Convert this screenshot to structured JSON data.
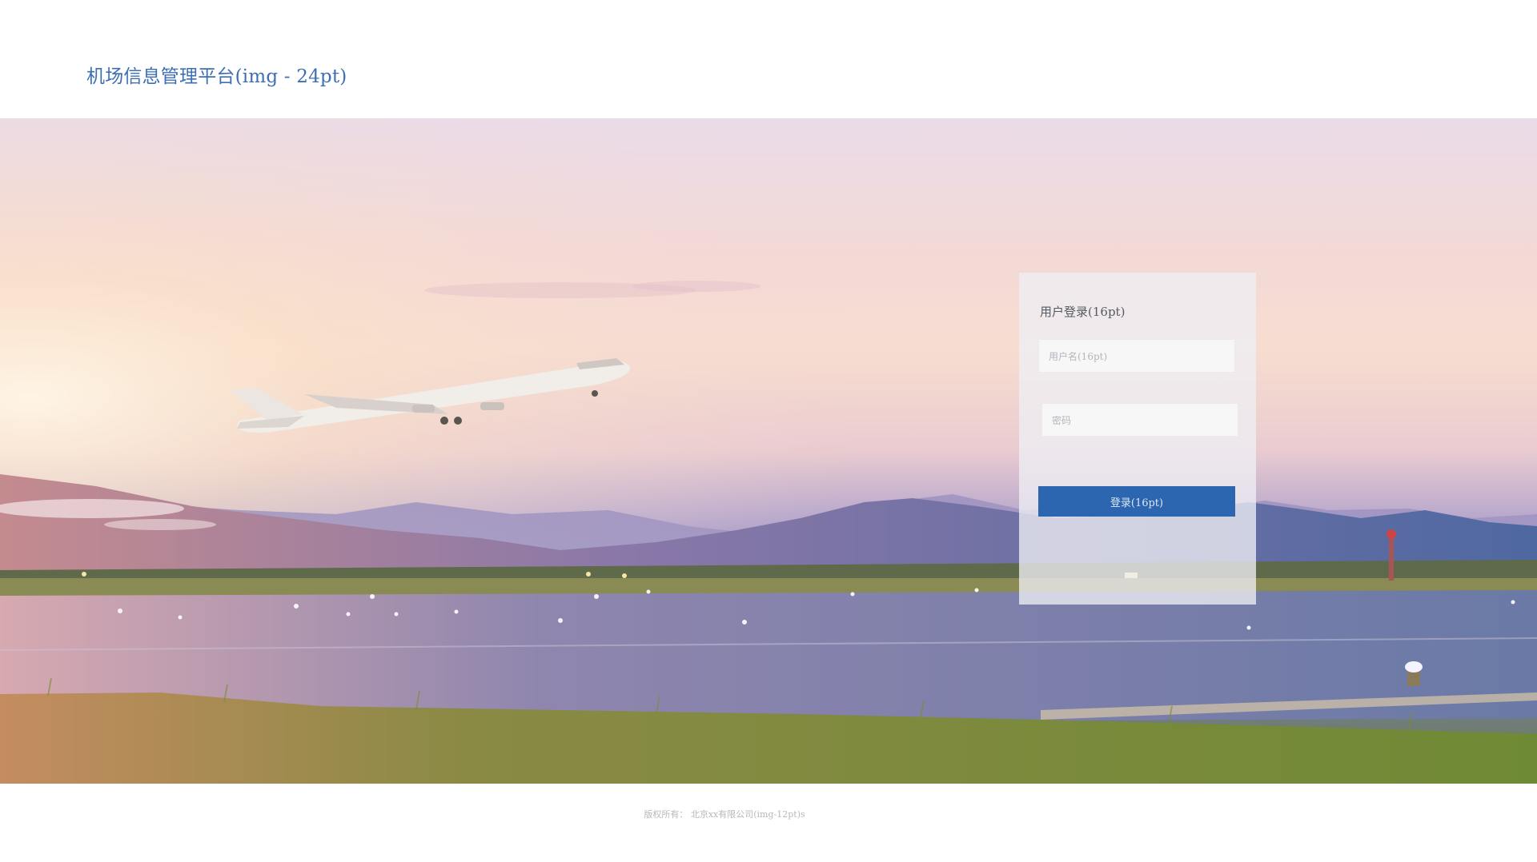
{
  "header": {
    "app_title": "机场信息管理平台(img - 24pt)"
  },
  "hero": {
    "image_name": "airplane-takeoff-runway-image"
  },
  "login": {
    "title": "用户登录(16pt)",
    "username_placeholder": "用户名(16pt)",
    "password_placeholder": "密码",
    "submit_label": "登录(16pt)"
  },
  "footer": {
    "copyright": "版权所有：  北京xx有限公司(img-12pt)s"
  },
  "colors": {
    "title_blue": "#3d6fb5",
    "button_blue": "#2c65b0",
    "panel_bg": "#eeeef3"
  }
}
